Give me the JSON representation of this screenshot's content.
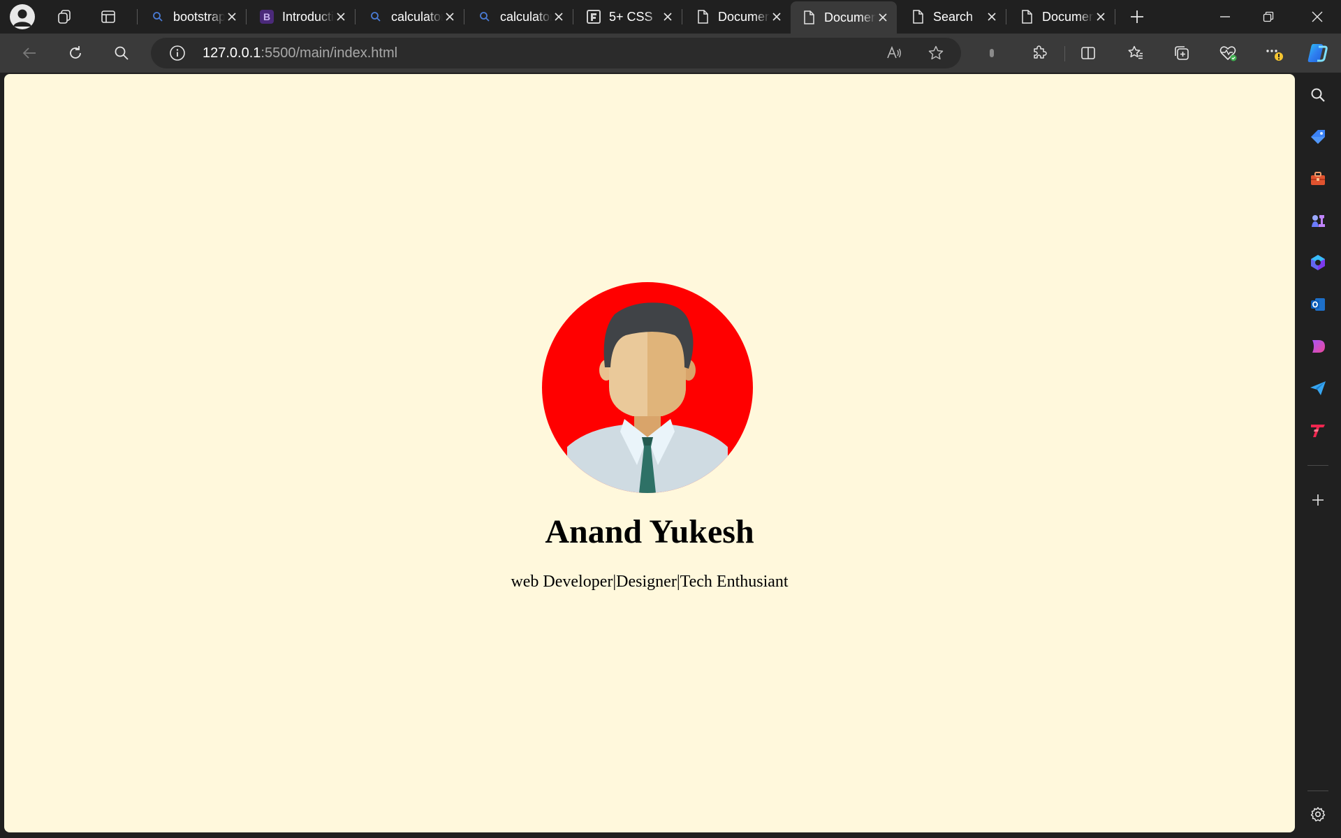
{
  "browser": {
    "tabs": [
      {
        "title": "bootstrap",
        "favicon": "search-icon",
        "active": false
      },
      {
        "title": "Introduction",
        "favicon": "bootstrap-icon",
        "active": false
      },
      {
        "title": "calculator",
        "favicon": "search-icon",
        "active": false
      },
      {
        "title": "calculator",
        "favicon": "search-icon",
        "active": false
      },
      {
        "title": "5+ CSS",
        "favicon": "framework-icon",
        "active": false
      },
      {
        "title": "Document",
        "favicon": "page-icon",
        "active": false
      },
      {
        "title": "Document",
        "favicon": "page-icon",
        "active": true
      },
      {
        "title": "Search",
        "favicon": "page-icon",
        "active": false
      },
      {
        "title": "Document",
        "favicon": "page-icon",
        "active": false
      }
    ],
    "address": {
      "host": "127.0.0.1",
      "rest": ":5500/main/index.html"
    },
    "colors": {
      "chrome": "#202020",
      "toolbar": "#3a3a3a",
      "page_background": "#fff8dc",
      "profile_circle": "#ff0000"
    }
  },
  "page": {
    "name": "Anand Yukesh",
    "tagline": "web Developer|Designer|Tech Enthusiant",
    "profile_image": "male-avatar-illustration"
  }
}
